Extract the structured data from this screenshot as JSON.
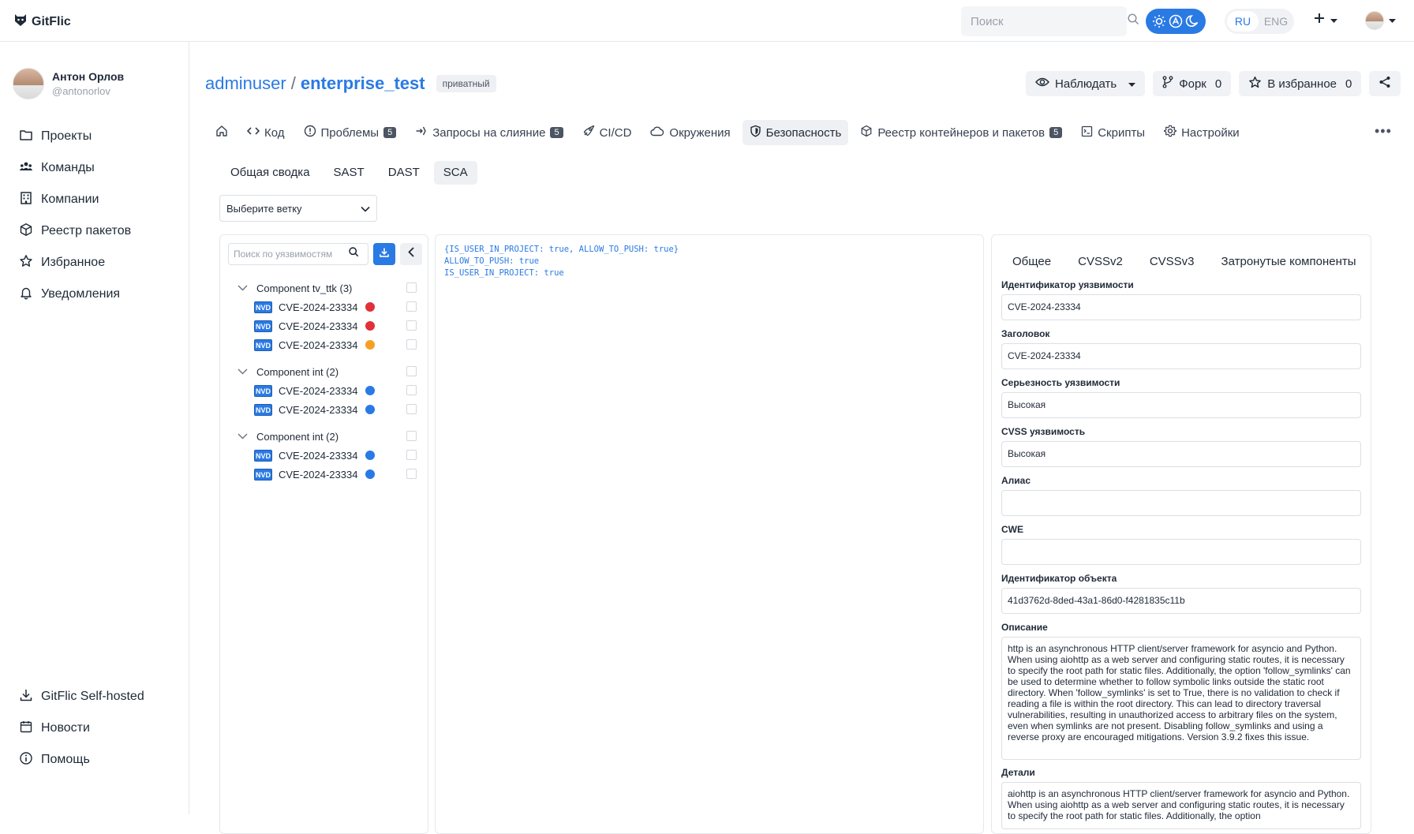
{
  "app": {
    "name": "GitFlic"
  },
  "topbar": {
    "search_placeholder": "Поиск",
    "lang": {
      "ru": "RU",
      "eng": "ENG",
      "active": "RU"
    },
    "accent": "#2a7ae4"
  },
  "user": {
    "name": "Антон Орлов",
    "handle": "@antonorlov"
  },
  "sidebar": {
    "items": [
      {
        "label": "Проекты",
        "icon": "folder-icon"
      },
      {
        "label": "Команды",
        "icon": "team-icon"
      },
      {
        "label": "Компании",
        "icon": "building-icon"
      },
      {
        "label": "Реестр пакетов",
        "icon": "package-icon"
      },
      {
        "label": "Избранное",
        "icon": "star-icon"
      },
      {
        "label": "Уведомления",
        "icon": "bell-icon"
      }
    ],
    "bottom": [
      {
        "label": "GitFlic Self-hosted",
        "icon": "download-icon"
      },
      {
        "label": "Новости",
        "icon": "calendar-icon"
      },
      {
        "label": "Помощь",
        "icon": "info-icon"
      }
    ]
  },
  "repo": {
    "owner": "adminuser",
    "separator": "/",
    "name": "enterprise_test",
    "visibility": "приватный",
    "watch_label": "Наблюдать",
    "fork_label": "Форк",
    "fork_count": "0",
    "fav_label": "В избранное",
    "fav_count": "0"
  },
  "tabs": [
    {
      "label": "",
      "icon": "home-icon"
    },
    {
      "label": "Код",
      "icon": "code-icon"
    },
    {
      "label": "Проблемы",
      "icon": "issue-icon",
      "count": "5"
    },
    {
      "label": "Запросы на слияние",
      "icon": "merge-icon",
      "count": "5"
    },
    {
      "label": "CI/CD",
      "icon": "rocket-icon"
    },
    {
      "label": "Окружения",
      "icon": "cloud-icon"
    },
    {
      "label": "Безопасность",
      "icon": "shield-icon",
      "active": true
    },
    {
      "label": "Реестр контейнеров и пакетов",
      "icon": "box-icon",
      "count": "5"
    },
    {
      "label": "Скрипты",
      "icon": "script-icon"
    },
    {
      "label": "Настройки",
      "icon": "gear-icon"
    }
  ],
  "subtabs": [
    {
      "label": "Общая сводка"
    },
    {
      "label": "SAST"
    },
    {
      "label": "DAST"
    },
    {
      "label": "SCA",
      "active": true
    }
  ],
  "branch_select": {
    "placeholder": "Выберите ветку"
  },
  "vuln_panel": {
    "search_placeholder": "Поиск по уязвимостям",
    "groups": [
      {
        "title": "Component tv_ttk (3)",
        "items": [
          {
            "source": "NVD",
            "id": "CVE-2024-23334",
            "color": "#e0303a"
          },
          {
            "source": "NVD",
            "id": "CVE-2024-23334",
            "color": "#e0303a"
          },
          {
            "source": "NVD",
            "id": "CVE-2024-23334",
            "color": "#f5a024"
          }
        ]
      },
      {
        "title": "Component int (2)",
        "items": [
          {
            "source": "NVD",
            "id": "CVE-2024-23334",
            "color": "#2a7ae4"
          },
          {
            "source": "NVD",
            "id": "CVE-2024-23334",
            "color": "#2a7ae4"
          }
        ]
      },
      {
        "title": "Component int (2)",
        "items": [
          {
            "source": "NVD",
            "id": "CVE-2024-23334",
            "color": "#2a7ae4"
          },
          {
            "source": "NVD",
            "id": "CVE-2024-23334",
            "color": "#2a7ae4"
          }
        ]
      }
    ]
  },
  "code_panel": {
    "lines": [
      "{IS_USER_IN_PROJECT: true, ALLOW_TO_PUSH: true}",
      "ALLOW_TO_PUSH: true",
      "IS_USER_IN_PROJECT: true"
    ]
  },
  "details": {
    "tabs": [
      "Общее",
      "CVSSv2",
      "CVSSv3",
      "Затронутые компоненты"
    ],
    "fields": [
      {
        "label": "Идентификатор уязвимости",
        "value": "CVE-2024-23334"
      },
      {
        "label": "Заголовок",
        "value": "CVE-2024-23334"
      },
      {
        "label": "Серьезность уязвимости",
        "value": "Высокая"
      },
      {
        "label": "CVSS уязвимость",
        "value": "Высокая"
      },
      {
        "label": "Алиас",
        "value": ""
      },
      {
        "label": "CWE",
        "value": ""
      },
      {
        "label": "Идентификатор объекта",
        "value": "41d3762d-8ded-43a1-86d0-f4281835c11b"
      }
    ],
    "description_label": "Описание",
    "description": "http is an asynchronous HTTP client/server framework for asyncio and Python. When using aiohttp as a web server and configuring static routes, it is necessary to specify the root path for static files. Additionally, the option 'follow_symlinks' can be used to determine whether to follow symbolic links outside the static root directory. When 'follow_symlinks' is set to True, there is no validation to check if reading a file is within the root directory. This can lead to directory traversal vulnerabilities, resulting in unauthorized access to arbitrary files on the system, even when symlinks are not present.  Disabling follow_symlinks and using a reverse proxy are encouraged mitigations.  Version 3.9.2 fixes this issue.",
    "details_label": "Детали",
    "details_text": "aiohttp is an asynchronous HTTP client/server framework for asyncio and Python. When using aiohttp as a web server and configuring static routes, it is necessary to specify the root path for static files. Additionally, the option"
  }
}
